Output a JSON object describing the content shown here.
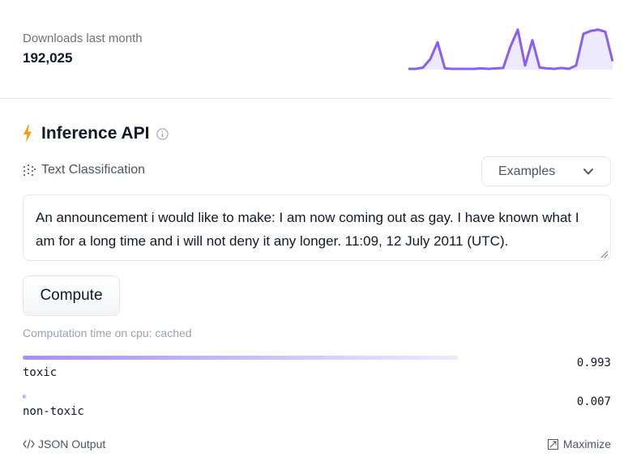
{
  "downloads": {
    "label": "Downloads last month",
    "count": "192,025"
  },
  "sparkline": {
    "values": [
      0.02,
      0.02,
      0.05,
      0.25,
      0.65,
      0.03,
      0.02,
      0.02,
      0.02,
      0.02,
      0.03,
      0.02,
      0.03,
      0.04,
      0.55,
      0.95,
      0.1,
      0.7,
      0.05,
      0.03,
      0.02,
      0.04,
      0.02,
      0.1,
      0.85,
      0.92,
      0.95,
      0.9,
      0.2
    ],
    "color": "#8b5cf6",
    "fill": "#ede9fe"
  },
  "inference": {
    "title": "Inference API",
    "task": "Text Classification",
    "examples_label": "Examples",
    "input_text": "An announcement i would like to make: I am now coming out as gay. I have known what I am for a long time and i will not deny it any longer. 11:09, 12 July 2011 (UTC).",
    "compute_label": "Compute",
    "computation_time": "Computation time on cpu: cached",
    "results": [
      {
        "label": "toxic",
        "score": "0.993",
        "fraction": 0.993
      },
      {
        "label": "non-toxic",
        "score": "0.007",
        "fraction": 0.007
      }
    ]
  },
  "footer": {
    "json_output": "JSON Output",
    "maximize": "Maximize"
  },
  "colors": {
    "accent": "#f59e0b",
    "bar": "#a78bfa"
  }
}
